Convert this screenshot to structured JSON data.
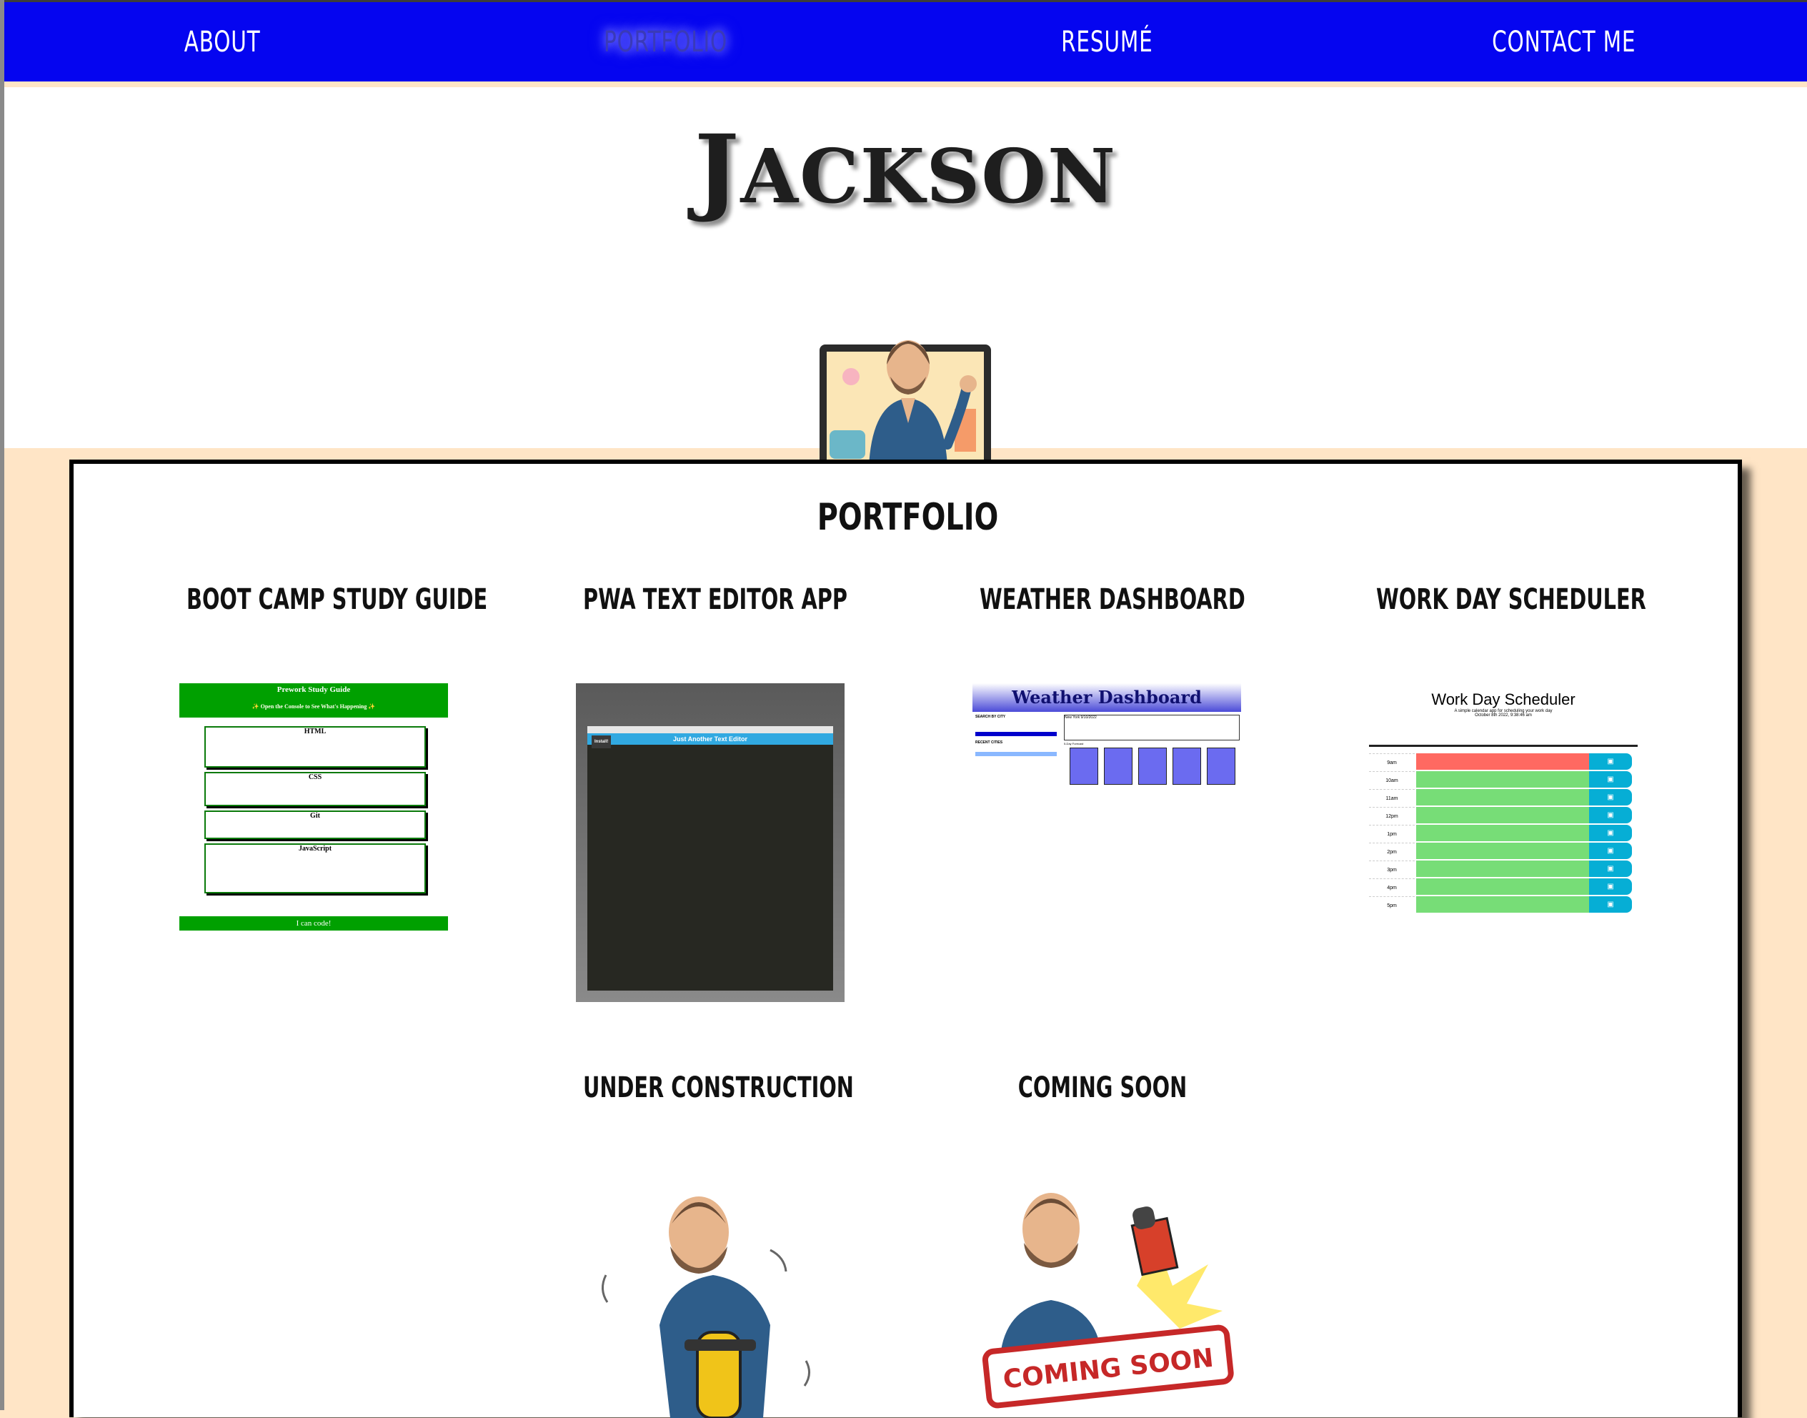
{
  "nav": {
    "items": [
      {
        "label": "About",
        "active": false
      },
      {
        "label": "Portfolio",
        "active": true
      },
      {
        "label": "Resumé",
        "active": false
      },
      {
        "label": "Contact Me",
        "active": false
      }
    ]
  },
  "header": {
    "name": "Jackson"
  },
  "portfolio": {
    "title": "PORTFOLIO",
    "projects": [
      {
        "title": "BOOT CAMP STUDY GUIDE",
        "thumb": {
          "heading": "Prework Study Guide",
          "subheading": "✨ Open the Console to See What's Happening ✨",
          "sections": [
            "HTML",
            "CSS",
            "Git",
            "JavaScript"
          ],
          "footer": "I can code!"
        }
      },
      {
        "title": "PWA TEXT EDITOR APP",
        "thumb": {
          "window_title": "Just Another Text Editor",
          "install_label": "Install!"
        }
      },
      {
        "title": "WEATHER DASHBOARD",
        "thumb": {
          "banner": "Weather Dashboard",
          "search_label": "SEARCH BY CITY",
          "recent_label": "RECENT CITIES",
          "city": "New York",
          "date": "9/10/2022",
          "forecast_label": "5-Day Forecast"
        }
      },
      {
        "title": "WORK DAY SCHEDULER",
        "thumb": {
          "heading": "Work Day Scheduler",
          "subtitle": "A simple calendar app for scheduling your work day",
          "date": "October 8th 2022, 9:38:46 am",
          "hours": [
            "9am",
            "10am",
            "11am",
            "12pm",
            "1pm",
            "2pm",
            "3pm",
            "4pm",
            "5pm"
          ]
        }
      },
      {
        "title": "UNDER CONSTRUCTION",
        "thumb": {}
      },
      {
        "title": "COMING SOON",
        "thumb": {
          "stamp": "COMING SOON"
        }
      }
    ]
  },
  "colors": {
    "nav_bg": "#0505f0",
    "page_bg": "#ffe5c6",
    "past_hour": "#ff6961",
    "future_hour": "#77dd77",
    "save_button": "#06aed5"
  }
}
